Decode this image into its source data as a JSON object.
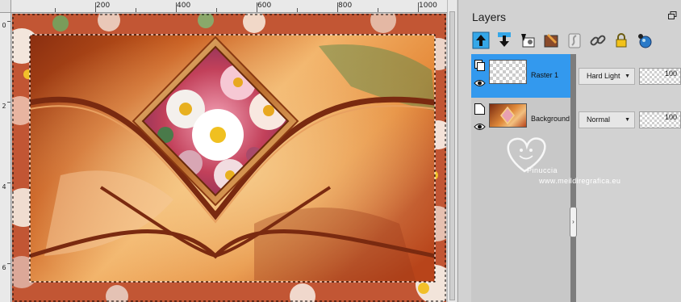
{
  "rulers": {
    "horizontal_labels": [
      "200",
      "400",
      "600",
      "800",
      "1000"
    ],
    "vertical_labels": [
      "0",
      "2",
      "4",
      "6"
    ]
  },
  "layers_panel": {
    "title": "Layers",
    "toolbar_icons": [
      "move-up-icon",
      "move-down-icon",
      "new-raster-layer-icon",
      "new-mask-layer-icon",
      "new-adjustment-layer-icon",
      "link-icon",
      "lock-icon",
      "view-effects-icon"
    ],
    "layers": [
      {
        "name": "Raster 1",
        "blend_mode": "Hard Light",
        "opacity": "100",
        "selected": true,
        "visible": true
      },
      {
        "name": "Background",
        "blend_mode": "Normal",
        "opacity": "100",
        "selected": false,
        "visible": true
      }
    ]
  },
  "watermark": {
    "name": "Pinuccia",
    "site": "www.meildiregrafica.eu"
  },
  "colors": {
    "selection": "#3399ee",
    "panel_bg": "#d2d2d2",
    "splitter": "#7d7d7d",
    "accent_orange": "#c8541f"
  }
}
